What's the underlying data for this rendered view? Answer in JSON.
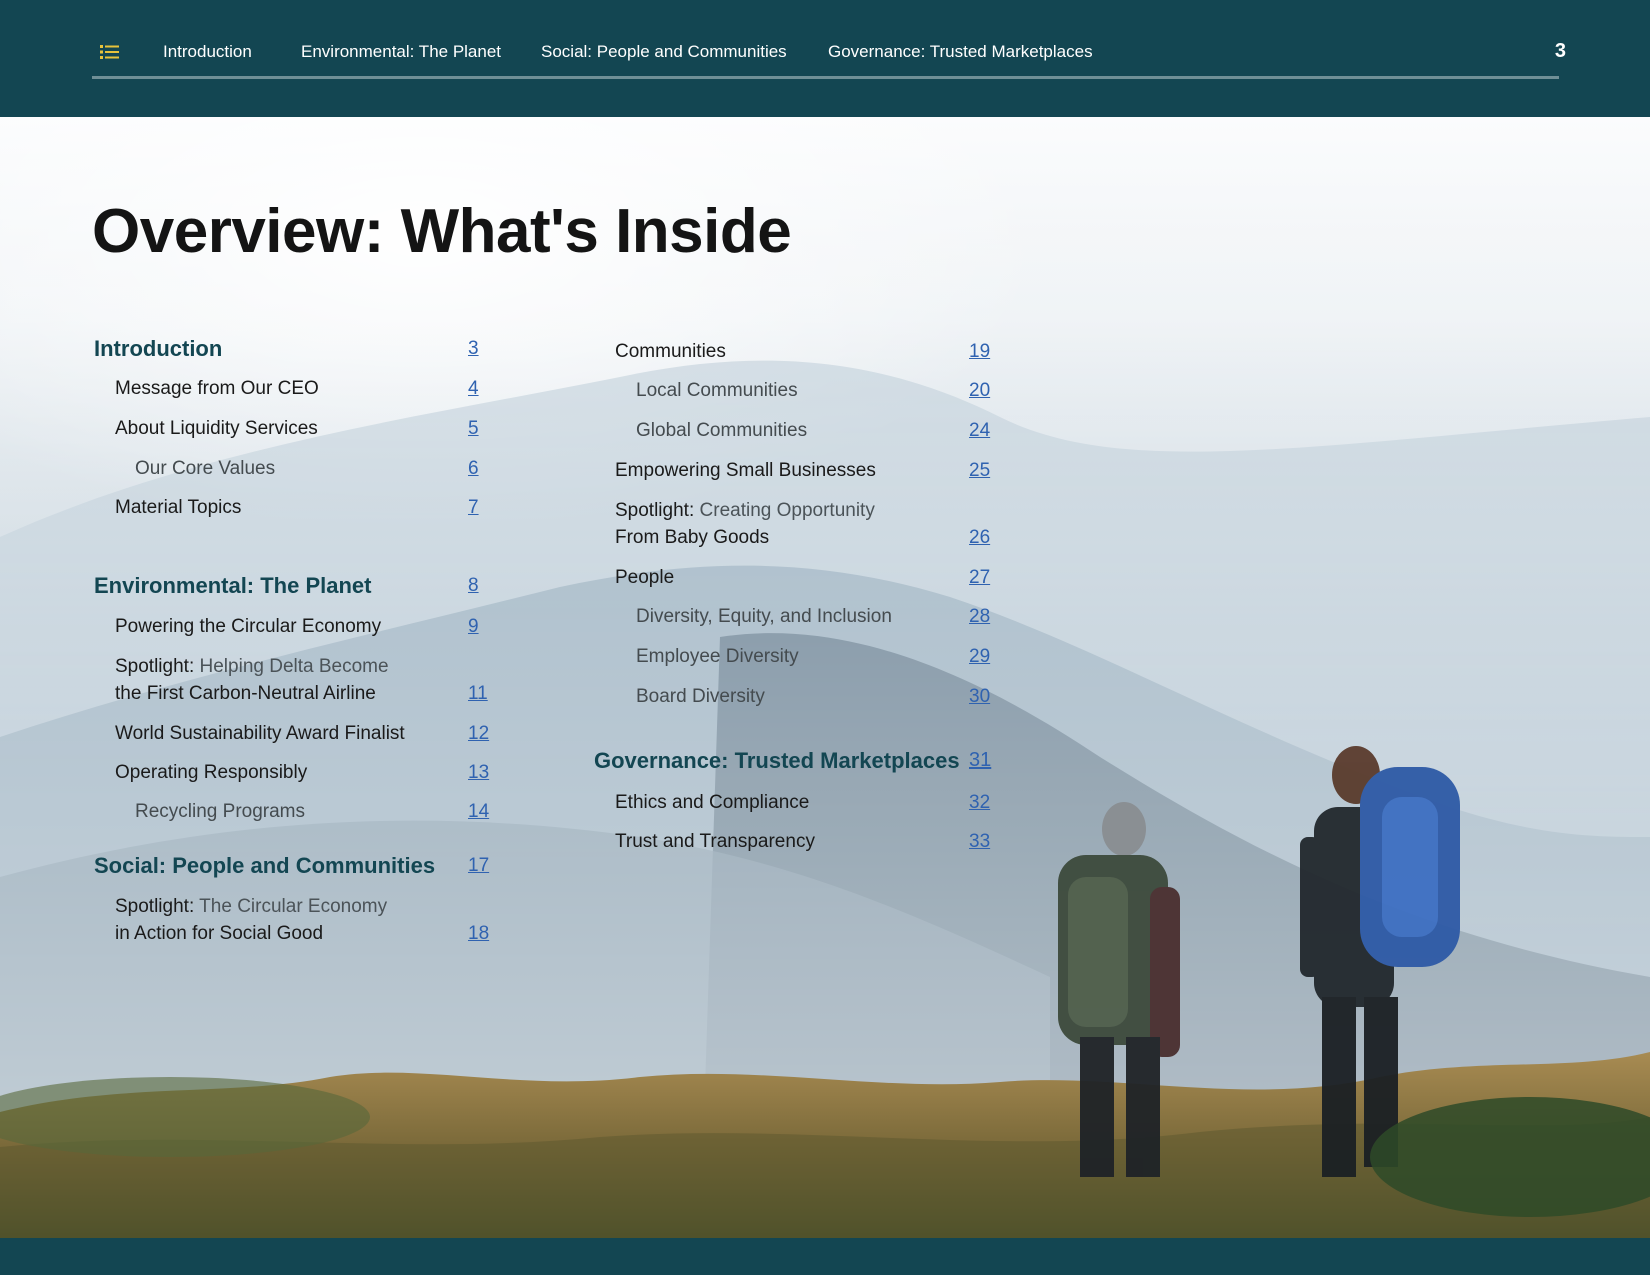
{
  "header": {
    "nav_items": [
      "Introduction",
      "Environmental: The Planet",
      "Social: People and Communities",
      "Governance: Trusted Marketplaces"
    ],
    "page_number": "3",
    "icon": "list-icon",
    "accent_color": "#134652",
    "icon_color": "#e7c33b"
  },
  "title": "Overview: What's Inside",
  "toc": {
    "left": [
      {
        "label": "Introduction",
        "page": "3",
        "level": "section"
      },
      {
        "label": "Message from Our CEO",
        "page": "4",
        "level": "item"
      },
      {
        "label": "About Liquidity Services",
        "page": "5",
        "level": "item"
      },
      {
        "label": "Our Core Values",
        "page": "6",
        "level": "sub"
      },
      {
        "label": "Material Topics",
        "page": "7",
        "level": "item"
      },
      {
        "label": "Environmental: The Planet",
        "page": "8",
        "level": "section"
      },
      {
        "label": "Powering the Circular Economy",
        "page": "9",
        "level": "item"
      },
      {
        "prefix": "Spotlight:",
        "line1": "Helping Delta Become",
        "line2": "the First Carbon-Neutral Airline",
        "page": "11",
        "level": "spotlight"
      },
      {
        "label": "World Sustainability Award Finalist",
        "page": "12",
        "level": "item"
      },
      {
        "label": "Operating Responsibly",
        "page": "13",
        "level": "item"
      },
      {
        "label": "Recycling Programs",
        "page": "14",
        "level": "sub"
      },
      {
        "label": "Social: People and Communities",
        "page": "17",
        "level": "section"
      },
      {
        "prefix": "Spotlight:",
        "line1": "The Circular Economy",
        "line2": "in Action for Social Good",
        "page": "18",
        "level": "spotlight"
      }
    ],
    "right": [
      {
        "label": "Communities",
        "page": "19",
        "level": "item"
      },
      {
        "label": "Local Communities",
        "page": "20",
        "level": "sub"
      },
      {
        "label": "Global Communities",
        "page": "24",
        "level": "sub"
      },
      {
        "label": "Empowering Small Businesses",
        "page": "25",
        "level": "item"
      },
      {
        "prefix": "Spotlight:",
        "line1": "Creating Opportunity",
        "line2": "From Baby Goods",
        "page": "26",
        "level": "spotlight"
      },
      {
        "label": "People",
        "page": "27",
        "level": "item"
      },
      {
        "label": "Diversity, Equity, and Inclusion",
        "page": "28",
        "level": "sub"
      },
      {
        "label": "Employee Diversity",
        "page": "29",
        "level": "sub"
      },
      {
        "label": "Board Diversity",
        "page": "30",
        "level": "sub"
      },
      {
        "label": "Governance: Trusted Marketplaces",
        "page": "31",
        "level": "section"
      },
      {
        "label": "Ethics and Compliance",
        "page": "32",
        "level": "item"
      },
      {
        "label": "Trust and Transparency",
        "page": "33",
        "level": "item"
      }
    ]
  }
}
